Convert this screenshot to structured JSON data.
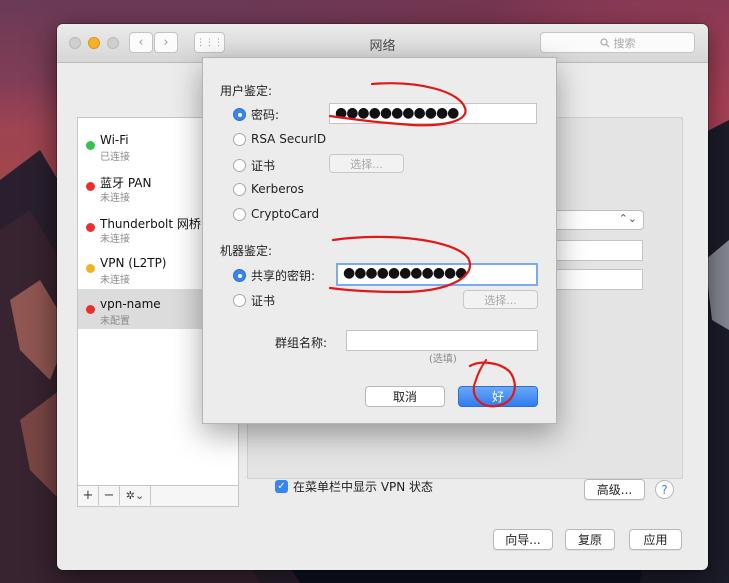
{
  "window": {
    "title": "网络"
  },
  "search": {
    "placeholder": "搜索",
    "icon": "search-icon"
  },
  "nav": {
    "back": "‹",
    "forward": "›",
    "grid": "⋮⋮⋮"
  },
  "sidebar": {
    "items": [
      {
        "name": "Wi-Fi",
        "status": "已连接",
        "dot": "#35c24a"
      },
      {
        "name": "蓝牙 PAN",
        "status": "未连接",
        "dot": "#e8302f"
      },
      {
        "name": "Thunderbolt 网桥",
        "status": "未连接",
        "dot": "#e8302f"
      },
      {
        "name": "VPN (L2TP)",
        "status": "未连接",
        "dot": "#f3b21f"
      },
      {
        "name": "vpn-name",
        "status": "未配置",
        "dot": "#e8302f"
      }
    ],
    "tools": {
      "add": "+",
      "remove": "−",
      "gear": "✲⌄"
    }
  },
  "sheet": {
    "user_auth_label": "用户鉴定:",
    "user_options": [
      {
        "label": "密码:",
        "selected": true
      },
      {
        "label": "RSA SecurID",
        "selected": false
      },
      {
        "label": "证书",
        "selected": false
      },
      {
        "label": "Kerberos",
        "selected": false
      },
      {
        "label": "CryptoCard",
        "selected": false
      }
    ],
    "password_value": "●●●●●●●●●●●",
    "select_button": "选择...",
    "machine_auth_label": "机器鉴定:",
    "machine_options": [
      {
        "label": "共享的密钥:",
        "selected": true
      },
      {
        "label": "证书",
        "selected": false
      }
    ],
    "shared_secret_value": "●●●●●●●●●●●",
    "machine_select_button": "选择...",
    "group_name_label": "群组名称:",
    "group_name_value": "",
    "group_hint": "(选填)",
    "cancel": "取消",
    "ok": "好"
  },
  "main": {
    "show_vpn_status": "在菜单栏中显示 VPN 状态",
    "show_vpn_checked": true,
    "advanced": "高级...",
    "help": "?"
  },
  "footer": {
    "assistant": "向导...",
    "revert": "复原",
    "apply": "应用"
  },
  "colors": {
    "accent": "#3a84f0",
    "annotation": "#e01818"
  }
}
